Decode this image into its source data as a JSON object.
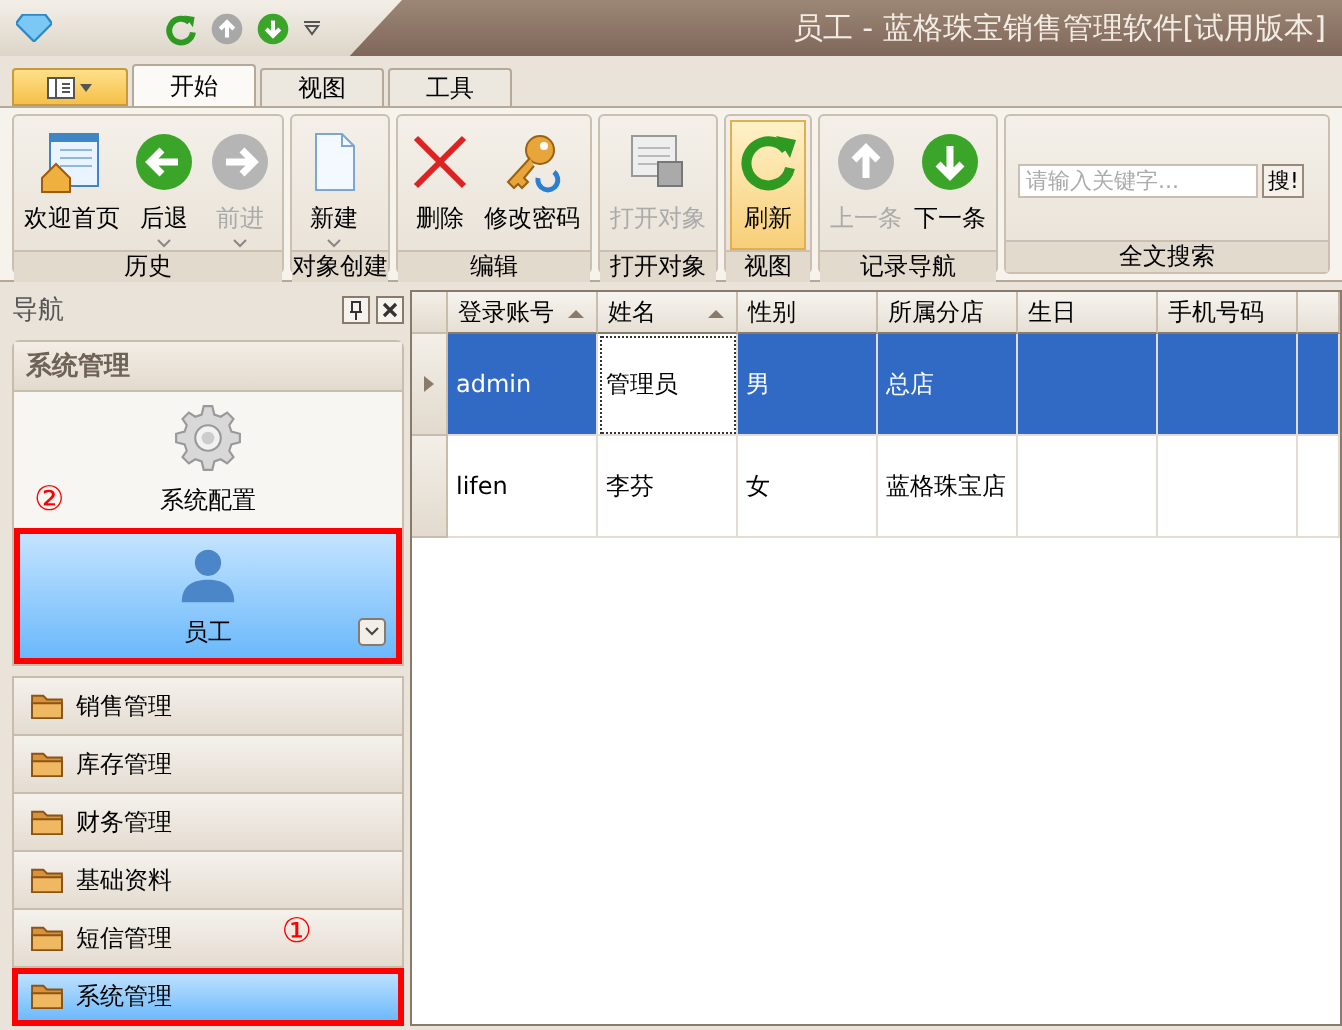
{
  "window": {
    "title": "员工 - 蓝格珠宝销售管理软件[试用版本]"
  },
  "quick_access": [
    {
      "kind": "refresh"
    },
    {
      "kind": "up-grey"
    },
    {
      "kind": "down"
    },
    {
      "kind": "more"
    }
  ],
  "ribbon_tabs": [
    {
      "label": "开始",
      "selected": true
    },
    {
      "label": "视图",
      "selected": false
    },
    {
      "label": "工具",
      "selected": false
    }
  ],
  "ribbon_groups": [
    {
      "label": "历史",
      "buttons": [
        {
          "label": "欢迎首页",
          "kind": "home",
          "disabled": false,
          "dropdown": false,
          "selected": false
        },
        {
          "label": "后退",
          "kind": "back",
          "disabled": false,
          "dropdown": true,
          "selected": false
        },
        {
          "label": "前进",
          "kind": "forward",
          "disabled": true,
          "dropdown": true,
          "selected": false
        }
      ]
    },
    {
      "label": "对象创建",
      "buttons": [
        {
          "label": "新建",
          "kind": "new",
          "disabled": false,
          "dropdown": true,
          "selected": false
        }
      ]
    },
    {
      "label": "编辑",
      "buttons": [
        {
          "label": "删除",
          "kind": "delete",
          "disabled": false,
          "dropdown": false,
          "selected": false
        },
        {
          "label": "修改密码",
          "kind": "key",
          "disabled": false,
          "dropdown": false,
          "selected": false
        }
      ]
    },
    {
      "label": "打开对象",
      "buttons": [
        {
          "label": "打开对象",
          "kind": "open",
          "disabled": true,
          "dropdown": false,
          "selected": false
        }
      ]
    },
    {
      "label": "视图",
      "buttons": [
        {
          "label": "刷新",
          "kind": "refresh",
          "disabled": false,
          "dropdown": false,
          "selected": true
        }
      ]
    },
    {
      "label": "记录导航",
      "buttons": [
        {
          "label": "上一条",
          "kind": "up",
          "disabled": true,
          "dropdown": false,
          "selected": false
        },
        {
          "label": "下一条",
          "kind": "down",
          "disabled": false,
          "dropdown": false,
          "selected": false
        }
      ]
    },
    {
      "label": "全文搜索",
      "search": {
        "placeholder": "请输入关键字...",
        "button": "搜!"
      }
    }
  ],
  "navigation": {
    "title": "导航",
    "group_title": "系统管理",
    "items": [
      {
        "label": "系统配置",
        "kind": "gear",
        "selected": false
      },
      {
        "label": "员工",
        "kind": "person",
        "selected": true,
        "callout": "②"
      }
    ],
    "buttons": [
      {
        "label": "销售管理",
        "selected": false
      },
      {
        "label": "库存管理",
        "selected": false
      },
      {
        "label": "财务管理",
        "selected": false
      },
      {
        "label": "基础资料",
        "selected": false
      },
      {
        "label": "短信管理",
        "selected": false
      },
      {
        "label": "系统管理",
        "selected": true,
        "callout": "①"
      }
    ]
  },
  "table": {
    "columns": [
      {
        "label": "登录账号",
        "sorted": true
      },
      {
        "label": "姓名",
        "sorted": true
      },
      {
        "label": "性别",
        "sorted": false
      },
      {
        "label": "所属分店",
        "sorted": false
      },
      {
        "label": "生日",
        "sorted": false
      },
      {
        "label": "手机号码",
        "sorted": false
      }
    ],
    "rows": [
      {
        "selected": true,
        "cells": [
          {
            "text": "admin",
            "focused": false
          },
          {
            "text": "管理员",
            "focused": true
          },
          {
            "text": "男",
            "focused": false
          },
          {
            "text": "总店",
            "focused": false
          }
        ]
      },
      {
        "selected": false,
        "cells": [
          {
            "text": "lifen",
            "focused": false
          },
          {
            "text": "李芬",
            "focused": false
          },
          {
            "text": "女",
            "focused": false
          },
          {
            "text": "蓝格珠宝店",
            "focused": false
          }
        ]
      }
    ]
  }
}
